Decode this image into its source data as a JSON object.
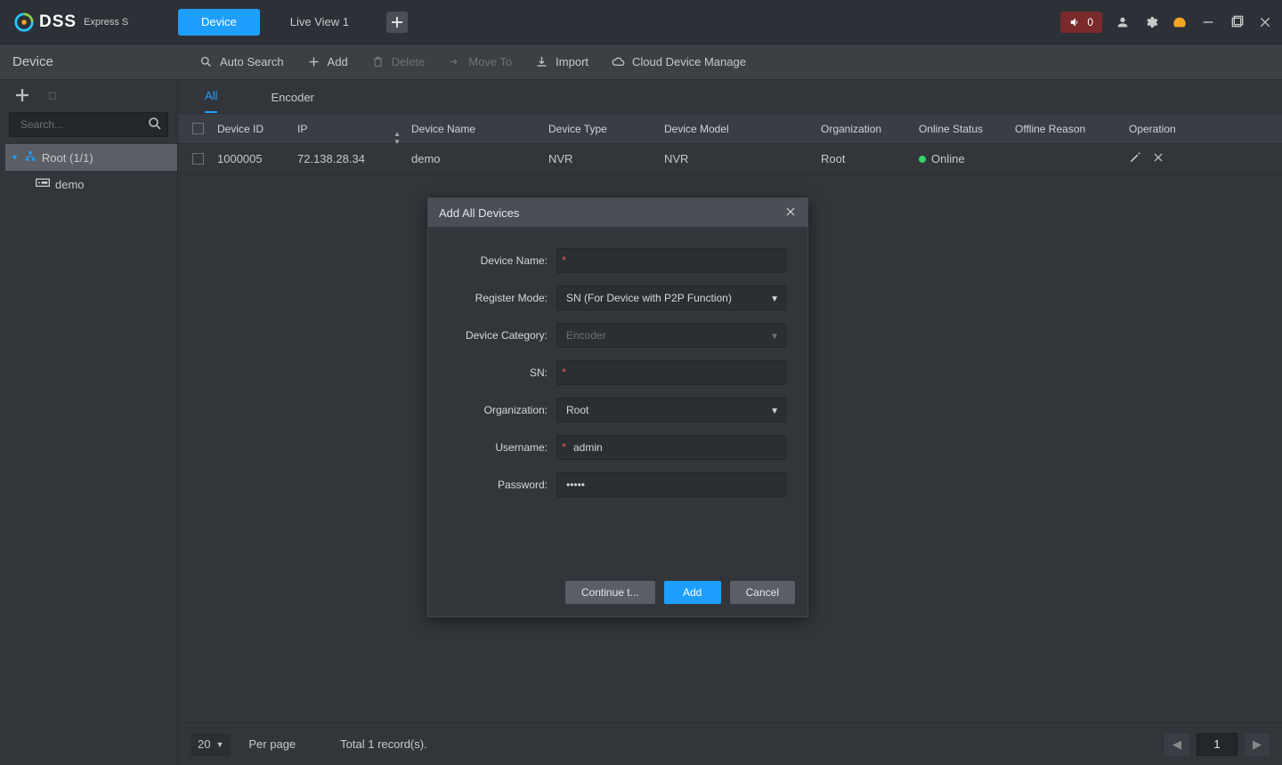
{
  "header": {
    "brand_main": "DSS",
    "brand_sub": "Express S",
    "tabs": [
      {
        "label": "Device",
        "active": true
      },
      {
        "label": "Live View 1",
        "active": false
      }
    ],
    "alert_count": "0"
  },
  "subbar": {
    "title": "Device",
    "actions": {
      "auto_search": "Auto Search",
      "add": "Add",
      "delete": "Delete",
      "move_to": "Move To",
      "import": "Import",
      "cloud": "Cloud Device Manage"
    }
  },
  "sidebar": {
    "search_placeholder": "Search...",
    "root_label": "Root (1/1)",
    "child_label": "demo"
  },
  "tabs2": {
    "all": "All",
    "encoder": "Encoder"
  },
  "table": {
    "headers": {
      "device_id": "Device ID",
      "ip": "IP",
      "device_name": "Device Name",
      "device_type": "Device Type",
      "device_model": "Device Model",
      "organization": "Organization",
      "online_status": "Online Status",
      "offline_reason": "Offline Reason",
      "operation": "Operation"
    },
    "row": {
      "device_id": "1000005",
      "ip": "72.138.28.34",
      "device_name": "demo",
      "device_type": "NVR",
      "device_model": "NVR",
      "organization": "Root",
      "online_status": "Online",
      "offline_reason": ""
    }
  },
  "dialog": {
    "title": "Add All Devices",
    "labels": {
      "device_name": "Device Name:",
      "register_mode": "Register Mode:",
      "device_category": "Device Category:",
      "sn": "SN:",
      "organization": "Organization:",
      "username": "Username:",
      "password": "Password:"
    },
    "values": {
      "register_mode": "SN (For Device with P2P Function)",
      "device_category": "Encoder",
      "organization": "Root",
      "username": "admin",
      "password": "•••••"
    },
    "buttons": {
      "continue": "Continue t...",
      "add": "Add",
      "cancel": "Cancel"
    }
  },
  "pager": {
    "per_page_value": "20",
    "per_page_label": "Per page",
    "total": "Total 1 record(s).",
    "page": "1"
  }
}
